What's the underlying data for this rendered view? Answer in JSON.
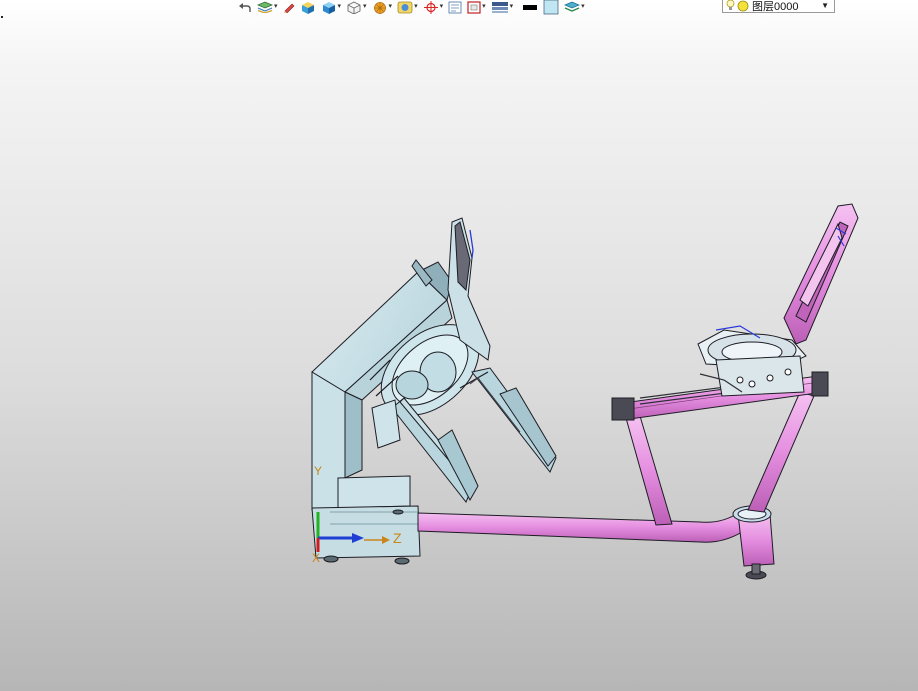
{
  "toolbar": {
    "buttons": [
      {
        "icon": "undo-arrow-icon",
        "has_dropdown": false
      },
      {
        "icon": "layer-stack-icon",
        "has_dropdown": true
      },
      {
        "icon": "pencil-icon",
        "has_dropdown": false
      },
      {
        "icon": "solid-box-icon",
        "has_dropdown": false
      },
      {
        "icon": "blue-cube-icon",
        "has_dropdown": true
      },
      {
        "icon": "wireframe-cube-icon",
        "has_dropdown": true
      },
      {
        "icon": "orange-gear-icon",
        "has_dropdown": true
      },
      {
        "icon": "view-orientation-icon",
        "has_dropdown": true
      },
      {
        "icon": "snap-point-icon",
        "has_dropdown": true
      },
      {
        "icon": "grid-document-icon",
        "has_dropdown": false
      },
      {
        "icon": "frame-select-icon",
        "has_dropdown": true
      },
      {
        "icon": "display-mode-icon",
        "has_dropdown": true
      },
      {
        "icon": "line-color-icon",
        "has_dropdown": false
      },
      {
        "icon": "fill-color-icon",
        "has_dropdown": false
      },
      {
        "icon": "layers-icon",
        "has_dropdown": true
      }
    ],
    "layer_select": {
      "value": "图层0000",
      "icons": [
        "lightbulb-icon",
        "yellow-circle-icon"
      ]
    }
  },
  "model": {
    "colors": {
      "frame_pink": "#e58ee0",
      "frame_pink_dark": "#c466c0",
      "body_blue": "#c2dde4",
      "body_blue_dark": "#a4c6cf",
      "edge": "#1d1d24"
    }
  },
  "axis_triad": {
    "z_label": "Z",
    "x_label": "X",
    "y_label": "Y",
    "colors": {
      "z": "#1f3fd4",
      "x": "#d01d1d",
      "y": "#22b322",
      "label": "#c9861a"
    }
  }
}
